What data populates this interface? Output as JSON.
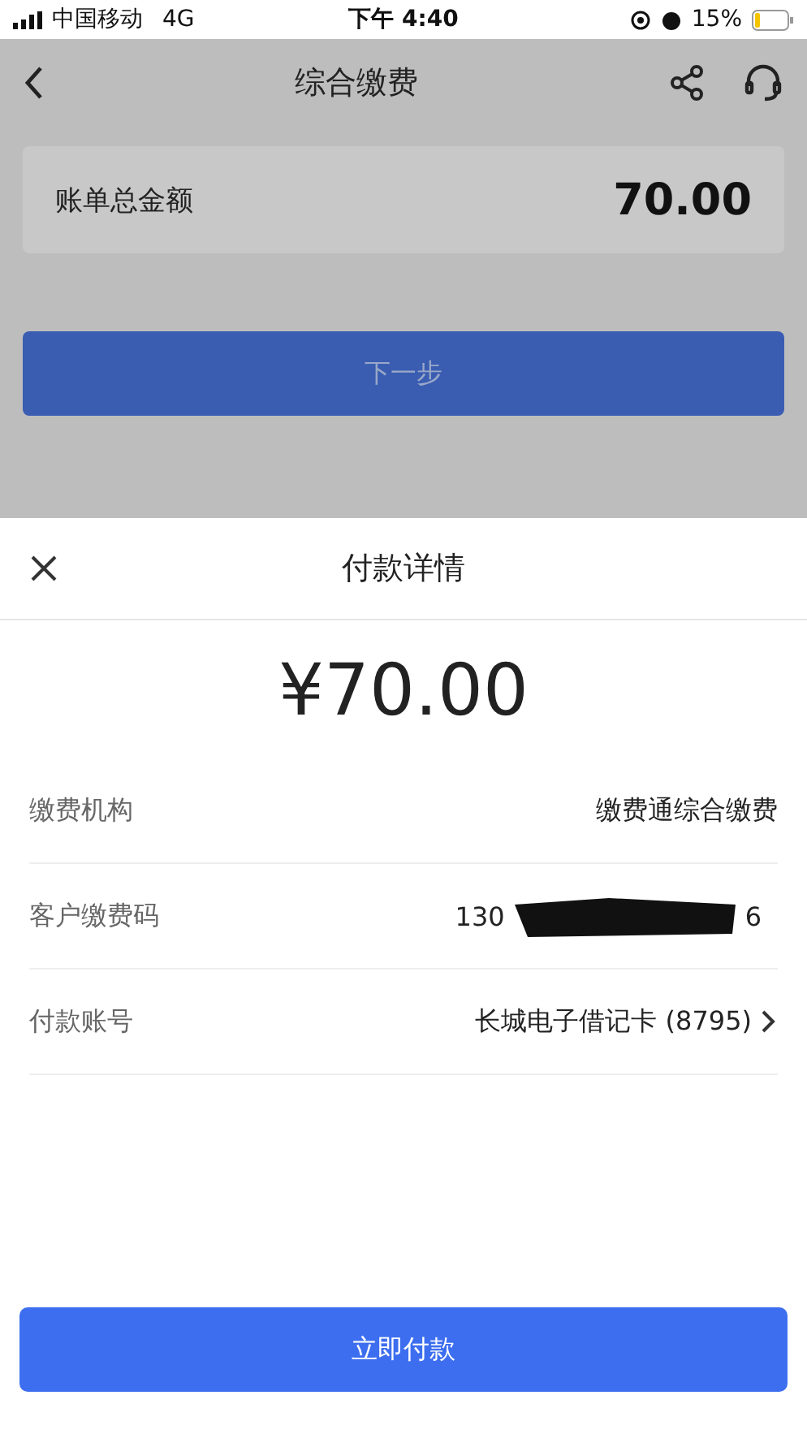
{
  "status_bar": {
    "carrier": "中国移动",
    "network": "4G",
    "time": "下午 4:40",
    "battery": "15%"
  },
  "nav": {
    "title": "综合缴费"
  },
  "bill": {
    "label": "账单总金额",
    "amount": "70.00"
  },
  "next_button": {
    "label": "下一步",
    "disabled": true
  },
  "sheet": {
    "title": "付款详情",
    "amount": "¥70.00",
    "rows": [
      {
        "kind": "text",
        "label": "缴费机构",
        "value": "缴费通综合缴费"
      },
      {
        "kind": "redacted",
        "label": "客户缴费码",
        "value_start": "130",
        "value_end": "6"
      },
      {
        "kind": "link",
        "label": "付款账号",
        "value": "长城电子借记卡 (8795)"
      }
    ],
    "pay_button": {
      "label": "立即付款"
    }
  }
}
